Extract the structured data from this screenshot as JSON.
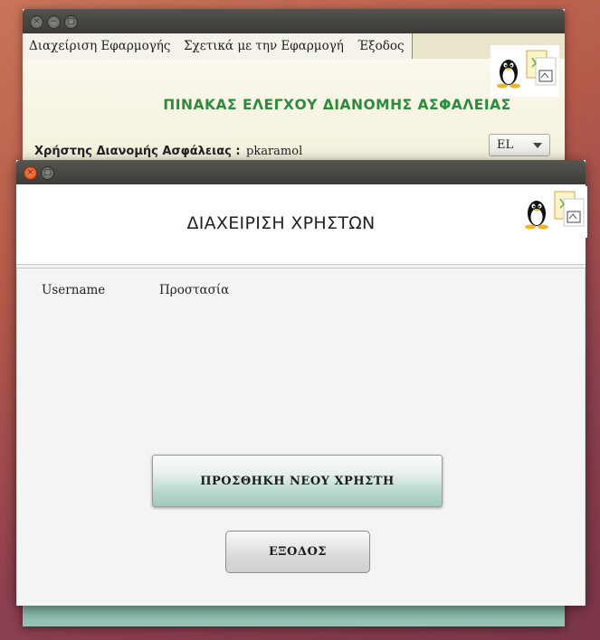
{
  "back_window": {
    "menu": [
      "Διαχείριση Εφαρμογής",
      "Σχετικά με την Εφαρμογή",
      "Έξοδος"
    ],
    "title": "ΠΙΝΑΚΑΣ ΕΛΕΓΧΟΥ ΔΙΑΝΟΜΗΣ ΑΣΦΑΛΕΙΑΣ",
    "user_label": "Χρήστης Διανομής Ασφάλειας :",
    "user_value": "pkaramol",
    "language": "EL"
  },
  "front_window": {
    "title": "ΔΙΑΧΕΙΡΙΣΗ ΧΡΗΣΤΩΝ",
    "columns": [
      "Username",
      "Προστασία"
    ],
    "add_button": "ΠΡΟΣΘΗΚΗ ΝΕΟΥ ΧΡΗΣΤΗ",
    "exit_button": "ΕΞΟΔΟΣ"
  },
  "colors": {
    "title_green": "#2e8b3e",
    "add_button_accent": "#9fcbbd",
    "close_button": "#d64a1e"
  },
  "icons": [
    "close-icon",
    "minimize-icon",
    "maximize-icon",
    "tux-logo-icon",
    "chevron-down-icon"
  ]
}
